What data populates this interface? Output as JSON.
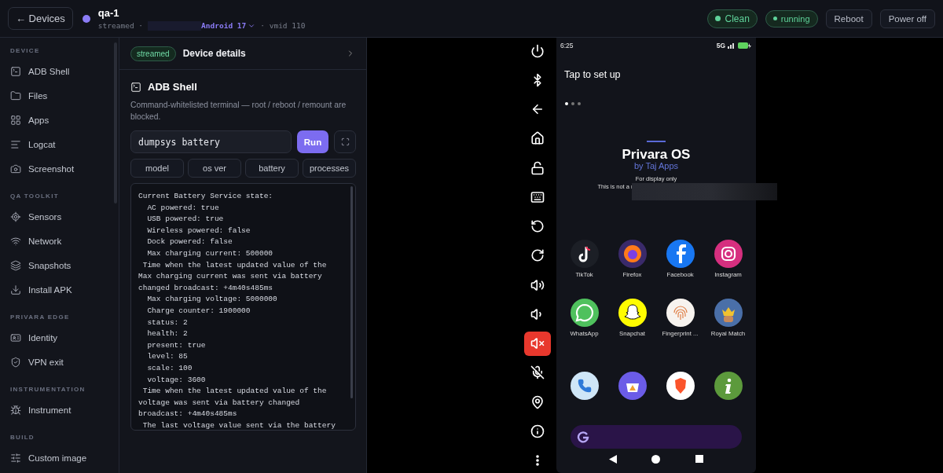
{
  "header": {
    "back_button": "← Devices",
    "device": {
      "name": "qa-1",
      "online": true,
      "mode": "streamed ·",
      "os": "Android 17",
      "vmid": "· vmid 110"
    },
    "status": [
      {
        "label": "Clean",
        "kind": "pill"
      },
      {
        "label": "running",
        "kind": "pill"
      }
    ],
    "actions": [
      "Reboot",
      "Power off"
    ]
  },
  "sidebar": [
    {
      "heading": "DEVICE",
      "items": [
        {
          "label": "ADB Shell",
          "kind": "terminal"
        },
        {
          "label": "Files",
          "kind": "folder"
        },
        {
          "label": "Apps",
          "kind": "grid"
        },
        {
          "label": "Logcat",
          "kind": "lines"
        },
        {
          "label": "Screenshot",
          "kind": "camera"
        }
      ]
    },
    {
      "heading": "QA TOOLKIT",
      "items": [
        {
          "label": "Sensors",
          "kind": "target"
        },
        {
          "label": "Network",
          "kind": "wifi"
        },
        {
          "label": "Snapshots",
          "kind": "layers"
        },
        {
          "label": "Install APK",
          "kind": "download"
        }
      ]
    },
    {
      "heading": "PRIVARA EDGE",
      "items": [
        {
          "label": "Identity",
          "kind": "card"
        },
        {
          "label": "VPN exit",
          "kind": "shield"
        }
      ]
    },
    {
      "heading": "INSTRUMENTATION",
      "items": [
        {
          "label": "Instrument",
          "kind": "bug"
        }
      ]
    },
    {
      "heading": "BUILD",
      "items": [
        {
          "label": "Custom image",
          "kind": "sliders"
        }
      ]
    }
  ],
  "panel": {
    "badge": "streamed",
    "title": "Device details",
    "section": {
      "title": "ADB Shell",
      "description": "Command-whitelisted terminal — root / reboot / remount are blocked.",
      "command": "dumpsys battery",
      "run": "Run",
      "presets": [
        "model",
        "os ver",
        "battery",
        "processes"
      ],
      "output": [
        "Current Battery Service state:",
        "  AC powered: true",
        "  USB powered: true",
        "  Wireless powered: false",
        "  Dock powered: false",
        "  Max charging current: 500000",
        " Time when the latest updated value of the",
        "Max charging current was sent via battery",
        "changed broadcast: +4m40s485ms",
        "  Max charging voltage: 5000000",
        "  Charge counter: 1900000",
        "  status: 2",
        "  health: 2",
        "  present: true",
        "  level: 85",
        "  scale: 100",
        "  voltage: 3600",
        " Time when the latest updated value of the",
        "voltage was sent via battery changed",
        "broadcast: +4m40s485ms",
        " The last voltage value sent via the battery"
      ]
    }
  },
  "phone_controls": [
    {
      "kind": "power",
      "active": false
    },
    {
      "kind": "bluetooth",
      "active": false
    },
    {
      "kind": "back",
      "active": false
    },
    {
      "kind": "home",
      "active": false
    },
    {
      "kind": "unlock",
      "active": false
    },
    {
      "kind": "keyboard",
      "active": false
    },
    {
      "kind": "rotate-left",
      "active": false
    },
    {
      "kind": "rotate-right",
      "active": false
    },
    {
      "kind": "volume-up",
      "active": false
    },
    {
      "kind": "volume-down",
      "active": false
    },
    {
      "kind": "mute",
      "active": true
    },
    {
      "kind": "mic-off",
      "active": false
    },
    {
      "kind": "location",
      "active": false
    },
    {
      "kind": "info",
      "active": false
    },
    {
      "kind": "more",
      "active": false
    }
  ],
  "phone": {
    "time": "6:25",
    "network": "5G",
    "setup": "Tap to set up",
    "page_dots": [
      {
        "selected": true
      },
      {
        "selected": false
      },
      {
        "selected": false
      }
    ],
    "brand": "Privara OS",
    "byline": "by Taj Apps",
    "notice": "For display only",
    "disclaimer": "This is not a r",
    "apps": [
      {
        "label": "TikTok",
        "kind": "tiktok",
        "color": "#1c1f26"
      },
      {
        "label": "Firefox",
        "kind": "firefox",
        "color": "#3a2a6a"
      },
      {
        "label": "Facebook",
        "kind": "facebook",
        "color": "#1877f2"
      },
      {
        "label": "Instagram",
        "kind": "instagram",
        "color": "#d62f7f"
      },
      {
        "label": "WhatsApp",
        "kind": "whatsapp",
        "color": "#4fc15d"
      },
      {
        "label": "Snapchat",
        "kind": "snapchat",
        "color": "#fffc00"
      },
      {
        "label": "Fingerprint ...",
        "kind": "fingerprint",
        "color": "#f7f3ef"
      },
      {
        "label": "Royal Match",
        "kind": "game",
        "color": "#4a6fa8"
      },
      {
        "kind": "phone",
        "color": "#cfe6f7"
      },
      {
        "kind": "store",
        "color": "#6b5ce7"
      },
      {
        "kind": "brave",
        "color": "#ffffff"
      },
      {
        "kind": "info",
        "color": "#5c9a3c"
      }
    ]
  }
}
